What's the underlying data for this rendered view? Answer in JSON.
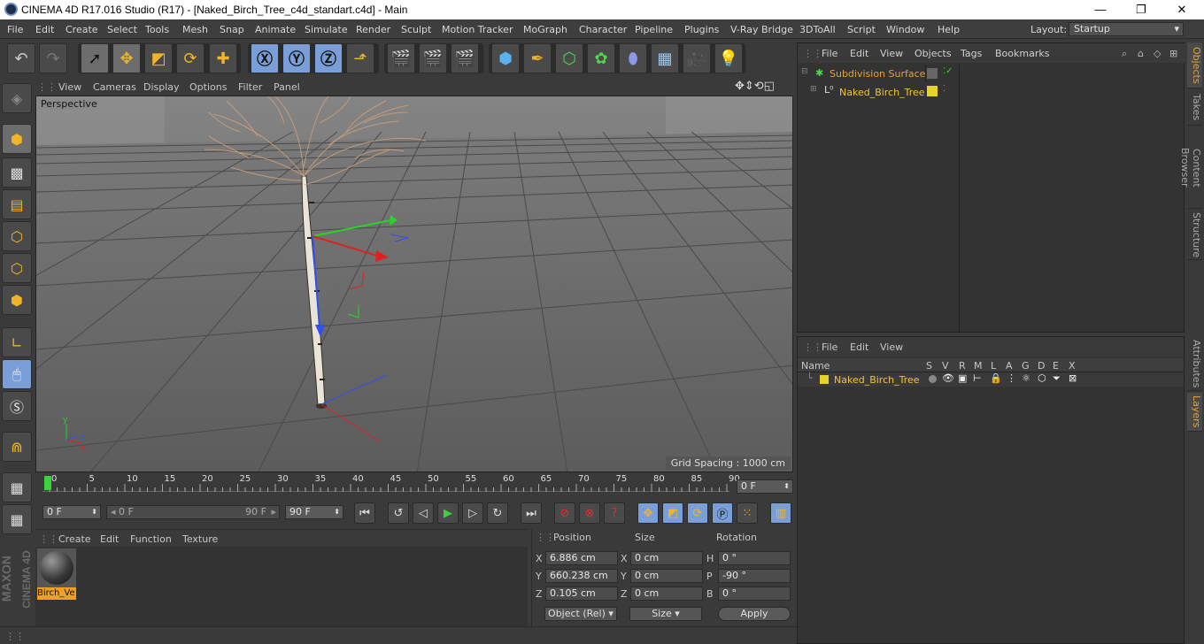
{
  "window": {
    "title": "CINEMA 4D R17.016 Studio (R17) - [Naked_Birch_Tree_c4d_standart.c4d] - Main",
    "minimize": "—",
    "restore": "❐",
    "close": "✕"
  },
  "menu": [
    "File",
    "Edit",
    "Create",
    "Select",
    "Tools",
    "Mesh",
    "Snap",
    "Animate",
    "Simulate",
    "Render",
    "Sculpt",
    "Motion Tracker",
    "MoGraph",
    "Character",
    "Pipeline",
    "Plugins",
    "V-Ray Bridge",
    "3DToAll",
    "Script",
    "Window",
    "Help"
  ],
  "layout": {
    "label": "Layout:",
    "value": "Startup"
  },
  "viewport": {
    "menu": [
      "View",
      "Cameras",
      "Display",
      "Options",
      "Filter",
      "Panel"
    ],
    "label": "Perspective",
    "grid_spacing": "Grid Spacing : 1000 cm"
  },
  "timeline": {
    "ticks": [
      "0",
      "5",
      "10",
      "15",
      "20",
      "25",
      "30",
      "35",
      "40",
      "45",
      "50",
      "55",
      "60",
      "65",
      "70",
      "75",
      "80",
      "85",
      "90"
    ],
    "current": "0 F"
  },
  "playbar": {
    "start": "0 F",
    "range_start": "0 F",
    "range_end": "90 F",
    "end": "90 F"
  },
  "materials": {
    "menu": [
      "Create",
      "Edit",
      "Function",
      "Texture"
    ],
    "item": "Birch_Ve"
  },
  "coords": {
    "headers": {
      "position": "Position",
      "size": "Size",
      "rotation": "Rotation"
    },
    "rows": [
      {
        "axis": "X",
        "pos": "6.886 cm",
        "saxis": "X",
        "size": "0 cm",
        "raxis": "H",
        "rot": "0 °"
      },
      {
        "axis": "Y",
        "pos": "660.238 cm",
        "saxis": "Y",
        "size": "0 cm",
        "raxis": "P",
        "rot": "-90 °"
      },
      {
        "axis": "Z",
        "pos": "0.105 cm",
        "saxis": "Z",
        "size": "0 cm",
        "raxis": "B",
        "rot": "0 °"
      }
    ],
    "mode": "Object (Rel)",
    "size_mode": "Size",
    "apply": "Apply"
  },
  "objects": {
    "menu": [
      "File",
      "Edit",
      "View",
      "Objects",
      "Tags",
      "Bookmarks"
    ],
    "items": [
      {
        "name": "Subdivision Surface",
        "color": "#e8a23a"
      },
      {
        "name": "Naked_Birch_Tree",
        "color": "#f2c53a"
      }
    ]
  },
  "layers": {
    "menu": [
      "File",
      "Edit",
      "View"
    ],
    "columns": [
      "Name",
      "S",
      "V",
      "R",
      "M",
      "L",
      "A",
      "G",
      "D",
      "E",
      "X"
    ],
    "item": "Naked_Birch_Tree"
  },
  "dock_tabs": [
    "Objects",
    "Takes",
    "Content Browser",
    "Structure",
    "Attributes",
    "Layers"
  ],
  "brand": {
    "line1": "MAXON",
    "line2": "CINEMA 4D"
  },
  "colors": {
    "accent_orange": "#e8a23a",
    "layer_yellow": "#e6d22a",
    "viewport_bg": "#767676"
  }
}
